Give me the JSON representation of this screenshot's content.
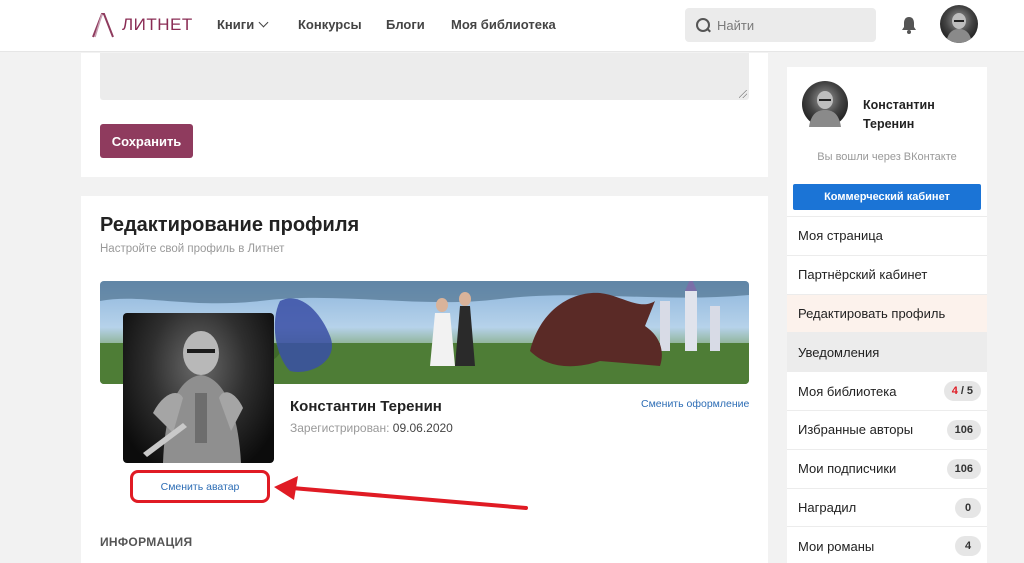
{
  "header": {
    "logo_text": "ЛИТНЕТ",
    "nav": [
      {
        "label": "Книги",
        "has_dropdown": true
      },
      {
        "label": "Конкурсы"
      },
      {
        "label": "Блоги"
      },
      {
        "label": "Моя библиотека"
      }
    ],
    "search_placeholder": "Найти",
    "icons": {
      "search": "search-icon",
      "notifications": "bell-icon",
      "user": "user-avatar"
    }
  },
  "top_card": {
    "save_label": "Сохранить"
  },
  "profile_edit": {
    "title": "Редактирование профиля",
    "subtitle": "Настройте свой профиль в Литнет",
    "user_name": "Константин Теренин",
    "registered_label": "Зарегистрирован:",
    "registered_date": "09.06.2020",
    "change_design_label": "Сменить оформление",
    "change_avatar_label": "Сменить аватар",
    "info_section_label": "ИНФОРМАЦИЯ"
  },
  "sidebar": {
    "user_name": "Константин Теренин",
    "login_note": "Вы вошли через ВКонтакте",
    "commercial_button": "Коммерческий кабинет",
    "menu": [
      {
        "label": "Моя страница"
      },
      {
        "label": "Партнёрский кабинет"
      },
      {
        "label": "Редактировать профиль",
        "active": true
      },
      {
        "label": "Уведомления",
        "hovered": true
      },
      {
        "label": "Моя библиотека",
        "badge_new": "4",
        "badge_sep": "/",
        "badge_total": "5"
      },
      {
        "label": "Избранные авторы",
        "badge": "106"
      },
      {
        "label": "Мои подписчики",
        "badge": "106"
      },
      {
        "label": "Наградил",
        "badge": "0"
      },
      {
        "label": "Мои романы",
        "badge": "4"
      }
    ]
  },
  "colors": {
    "brand": "#8f3b5e",
    "accent_blue": "#1b74d6",
    "link_blue": "#2d6db5",
    "highlight_red": "#e01b24"
  }
}
